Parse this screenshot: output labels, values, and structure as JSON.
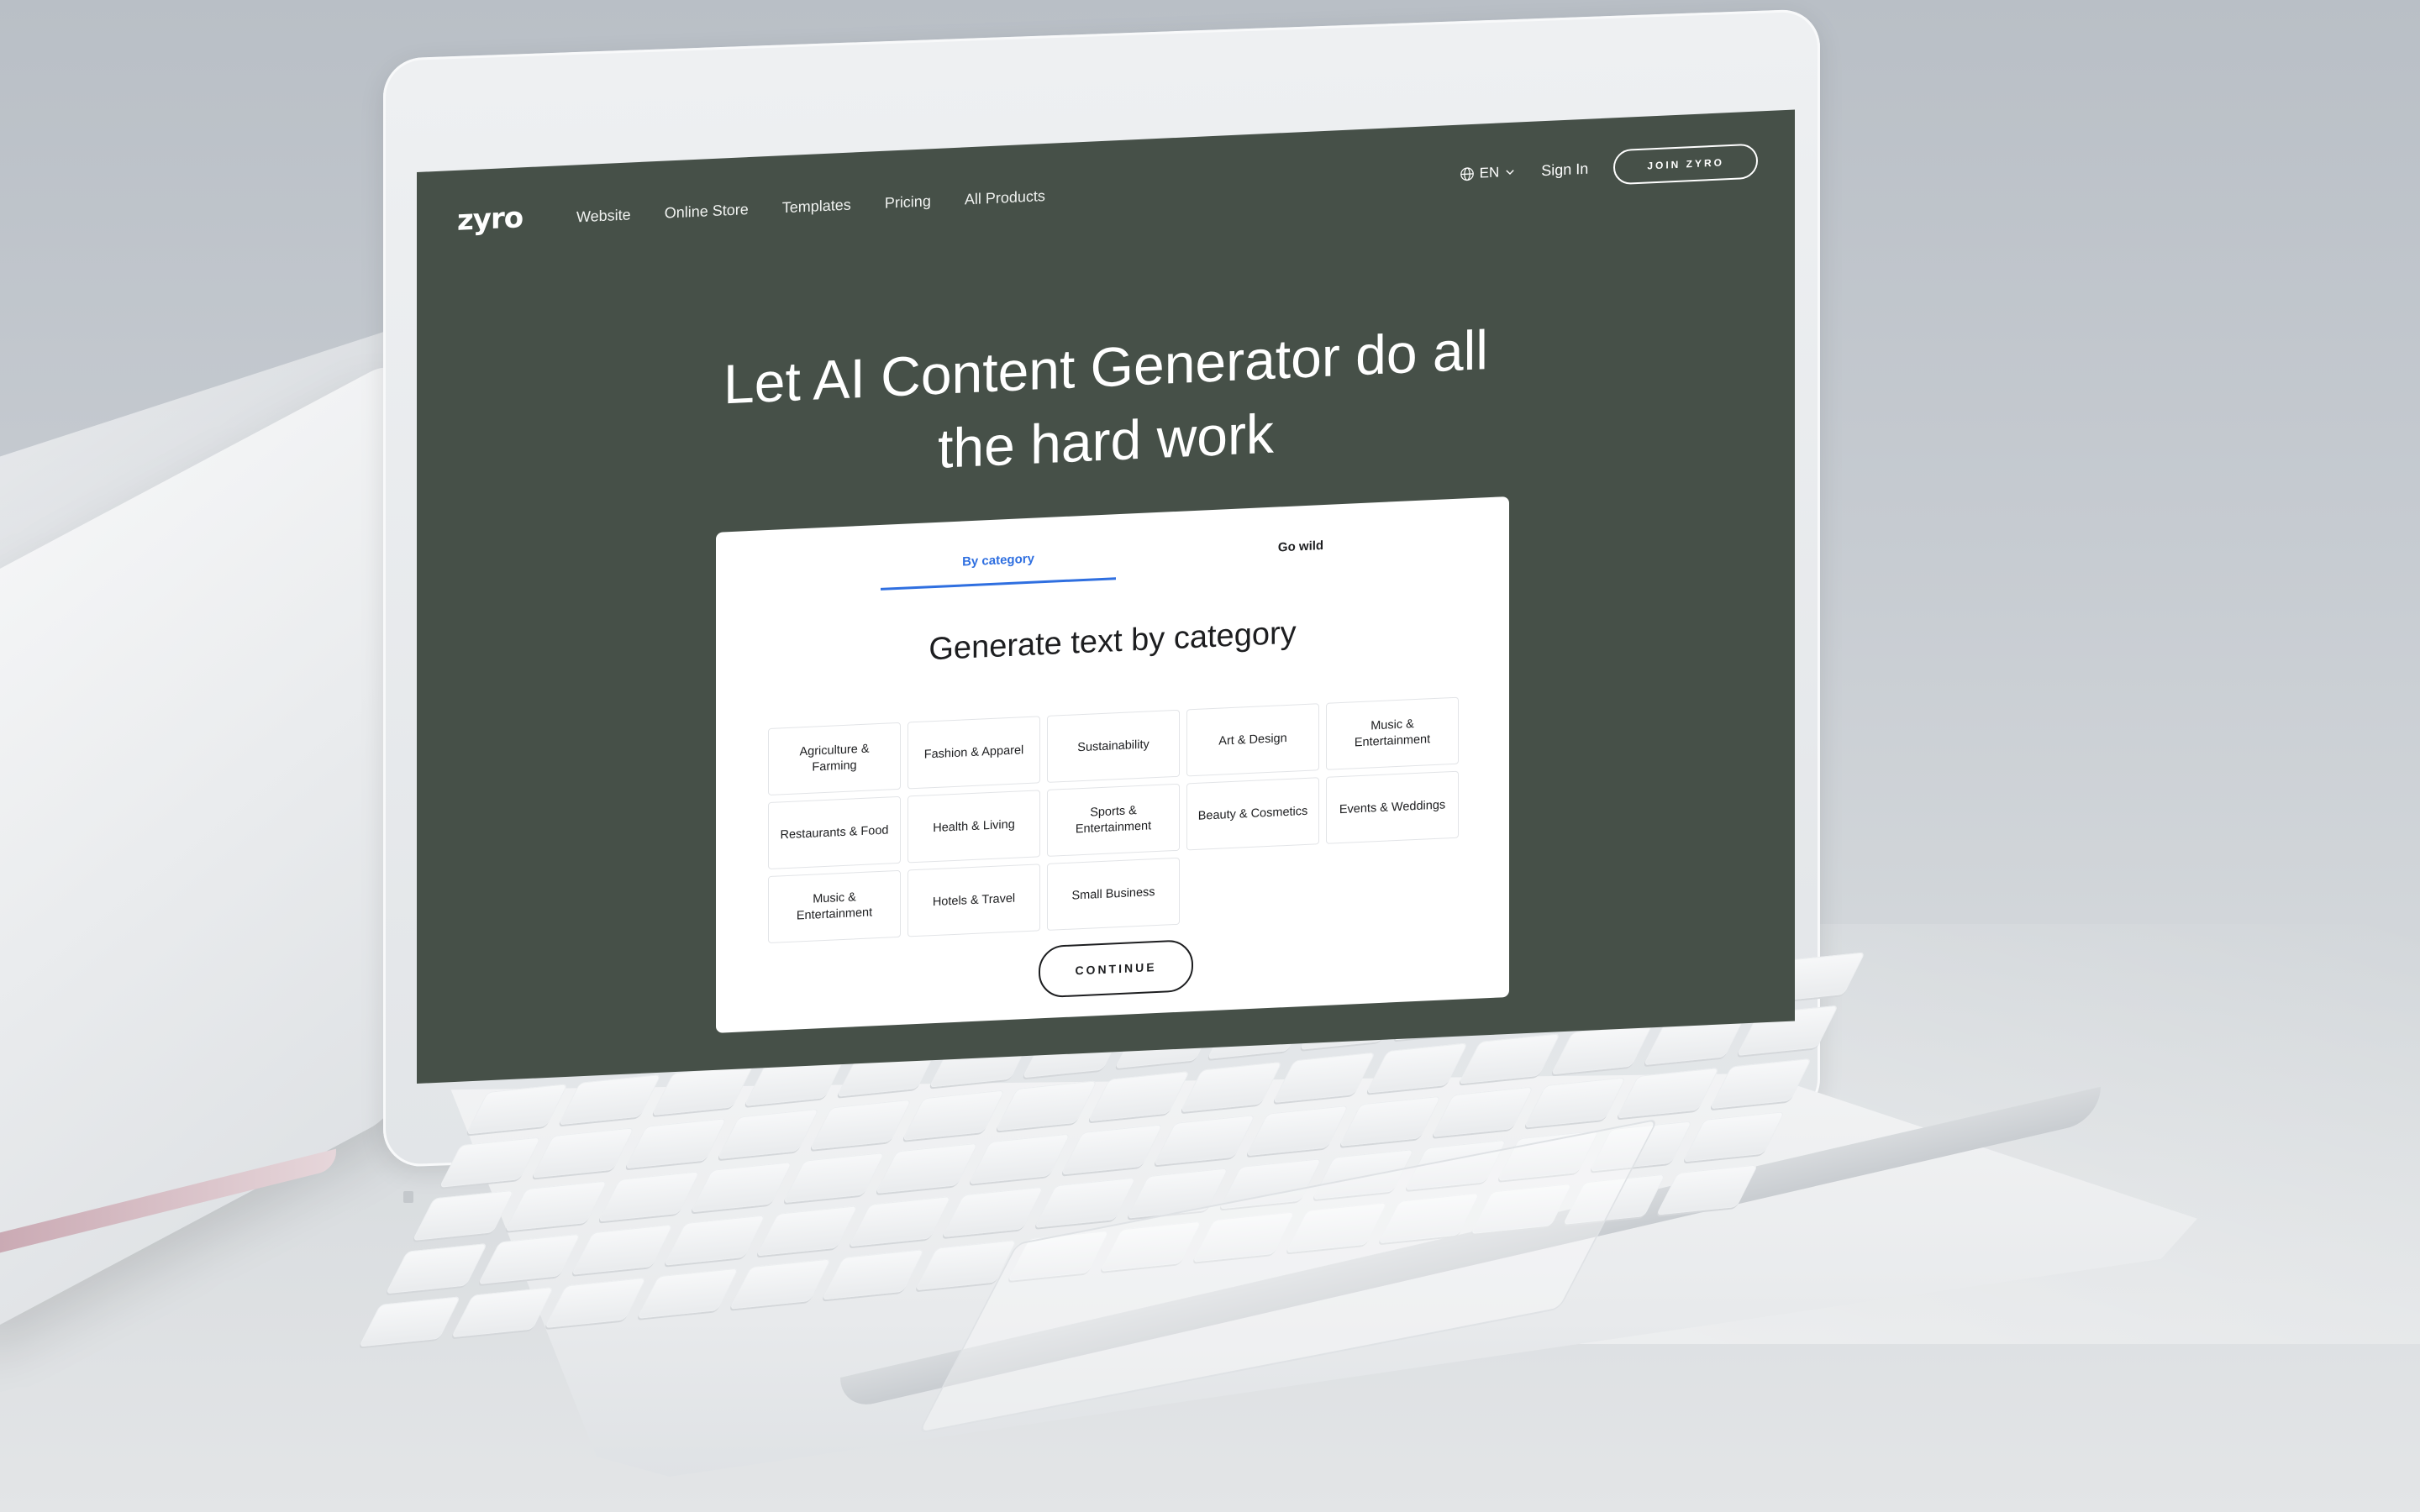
{
  "nav": {
    "logo": "zyro",
    "links": [
      "Website",
      "Online Store",
      "Templates",
      "Pricing",
      "All Products"
    ],
    "language": "EN",
    "sign_in": "Sign In",
    "join": "JOIN ZYRO"
  },
  "hero": {
    "title_line1": "Let AI Content Generator do all",
    "title_line2": "the hard work"
  },
  "card": {
    "tabs": {
      "active": "By category",
      "inactive": "Go wild"
    },
    "title": "Generate text by category",
    "categories": [
      "Agriculture & Farming",
      "Fashion & Apparel",
      "Sustainability",
      "Art  & Design",
      "Music & Entertainment",
      "Restaurants & Food",
      "Health & Living",
      "Sports & Entertainment",
      "Beauty & Cosmetics",
      "Events & Weddings",
      "Music & Entertainment",
      "Hotels & Travel",
      "Small Business"
    ],
    "continue": "CONTINUE"
  },
  "colors": {
    "page_bg": "#465048",
    "accent": "#2f6fe0",
    "text_dark": "#1d1e20"
  }
}
